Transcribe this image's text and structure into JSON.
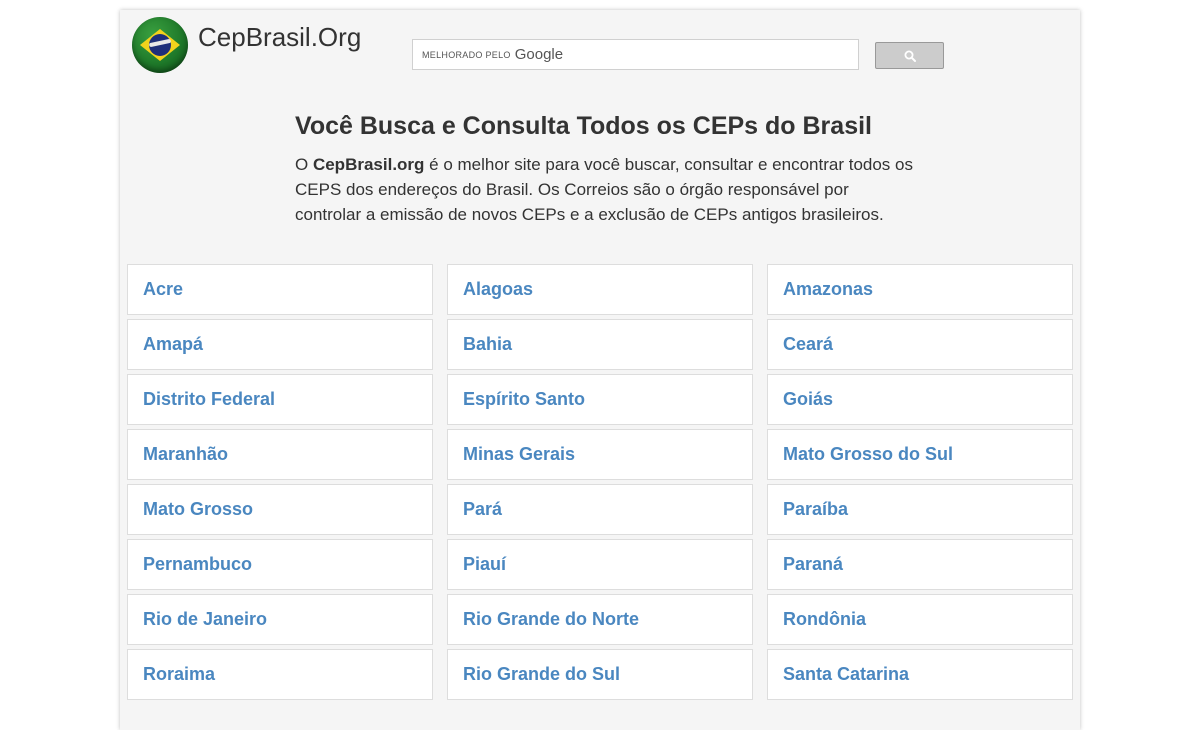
{
  "header": {
    "site_name": "CepBrasil.Org",
    "search": {
      "powered_by": "MELHORADO PELO",
      "brand": "Google",
      "placeholder": ""
    }
  },
  "intro": {
    "title": "Você Busca e Consulta Todos os CEPs do Brasil",
    "paragraph_before": "O ",
    "paragraph_bold": "CepBrasil.org",
    "paragraph_after": " é o melhor site para você buscar, consultar e encontrar todos os CEPS dos endereços do Brasil. Os Correios são o órgão responsável por controlar a emissão de novos CEPs e a exclusão de CEPs antigos brasileiros."
  },
  "states": [
    "Acre",
    "Alagoas",
    "Amazonas",
    "Amapá",
    "Bahia",
    "Ceará",
    "Distrito Federal",
    "Espírito Santo",
    "Goiás",
    "Maranhão",
    "Minas Gerais",
    "Mato Grosso do Sul",
    "Mato Grosso",
    "Pará",
    "Paraíba",
    "Pernambuco",
    "Piauí",
    "Paraná",
    "Rio de Janeiro",
    "Rio Grande do Norte",
    "Rondônia",
    "Roraima",
    "Rio Grande do Sul",
    "Santa Catarina"
  ],
  "icons": {
    "logo": "brazil-flag-icon",
    "search_button": "search-icon"
  },
  "colors": {
    "link": "#4a87c0",
    "background": "#f5f5f5"
  }
}
